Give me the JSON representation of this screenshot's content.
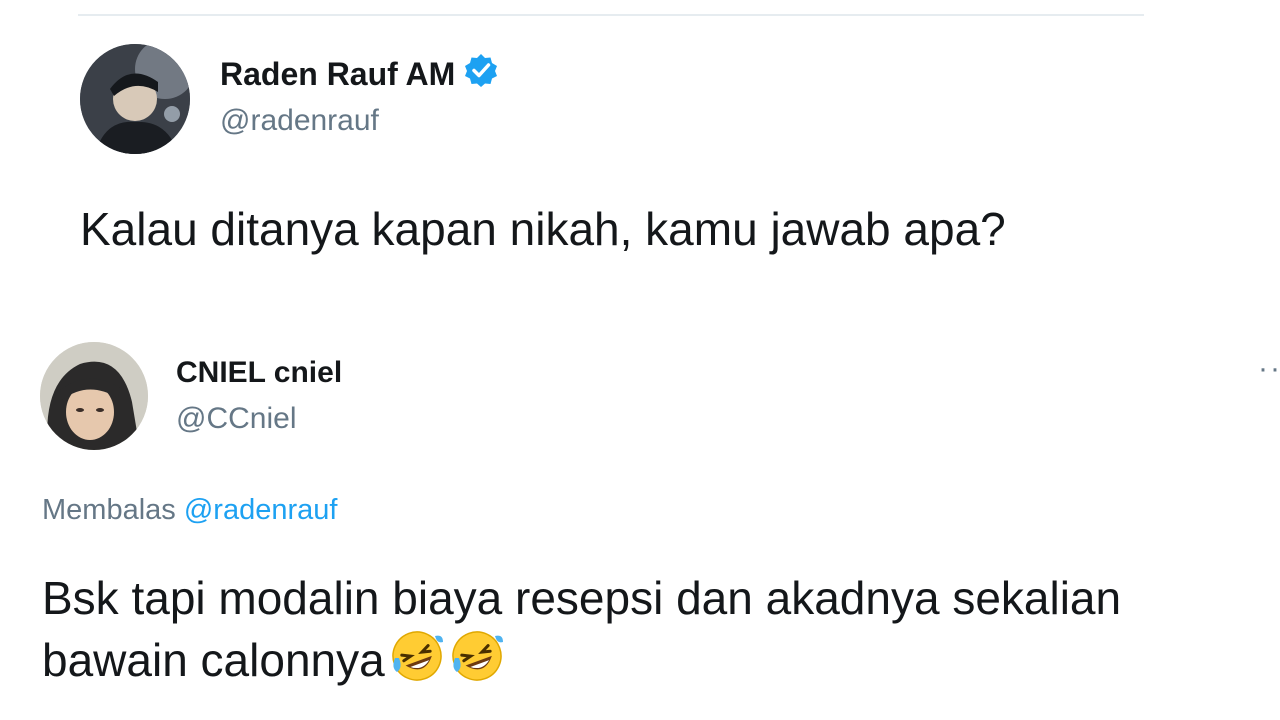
{
  "original_tweet": {
    "author_name": "Raden Rauf AM",
    "author_handle": "@radenrauf",
    "text": "Kalau ditanya kapan nikah, kamu jawab apa?"
  },
  "reply_tweet": {
    "author_name": "CNIEL cniel",
    "author_handle": "@CCniel",
    "replying_to_label": "Membalas",
    "replying_to_handle": "@radenrauf",
    "text_line1": "Bsk tapi modalin biaya resepsi dan akadnya sekalian",
    "text_line2": "bawain calonnya"
  },
  "icons": {
    "verified": "verified-badge-icon",
    "emoji": "rolling-on-floor-laughing-emoji",
    "more": "more-options-icon"
  },
  "colors": {
    "accent": "#1da1f2",
    "secondary_text": "#657786",
    "primary_text": "#14171a",
    "divider": "#e6ecf0"
  }
}
